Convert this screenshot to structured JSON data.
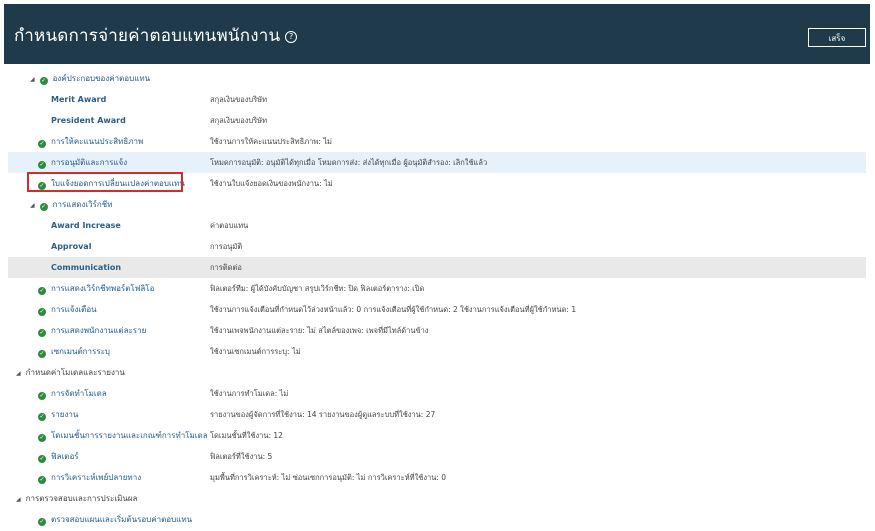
{
  "header": {
    "title": "กำหนดการจ่ายค่าตอบแทนพนักงาน",
    "help_icon": "help-circle-icon",
    "done_label": "เสร็จ"
  },
  "rows": [
    {
      "name": "comp-components",
      "label": "องค์ประกอบของค่าตอบแทน",
      "value": "",
      "expander": true,
      "check": true,
      "level": 1,
      "style": "",
      "interactable": true
    },
    {
      "name": "merit-award",
      "label": "Merit Award",
      "value": "สกุลเงินของบริษัท",
      "expander": false,
      "check": false,
      "level": "sub",
      "style": "",
      "interactable": false
    },
    {
      "name": "president-award",
      "label": "President Award",
      "value": "สกุลเงินของบริษัท",
      "expander": false,
      "check": false,
      "level": "sub",
      "style": "",
      "interactable": false
    },
    {
      "name": "performance-rating",
      "label": "การให้คะแนนประสิทธิภาพ",
      "value": "ใช้งานการให้คะแนนประสิทธิภาพ: ไม่",
      "expander": false,
      "check": true,
      "level": 1,
      "style": "",
      "interactable": true
    },
    {
      "name": "approval-notification",
      "label": "การอนุมัติและการแจ้ง",
      "value": "โหมดการอนุมัติ: อนุมัติได้ทุกเมื่อ  โหมดการส่ง: ส่งได้ทุกเมื่อ  ผู้อนุมัติสำรอง: เลิกใช้แล้ว",
      "expander": false,
      "check": true,
      "level": 1,
      "style": "hl-blue",
      "interactable": true
    },
    {
      "name": "comp-change-notice",
      "label": "ใบแจ้งยอดการเปลี่ยนแปลงค่าตอบแทน",
      "value": "ใช้งานใบแจ้งยอดเงินของพนักงาน: ไม่",
      "expander": false,
      "check": true,
      "level": 1,
      "style": "",
      "interactable": true
    },
    {
      "name": "workflow-display",
      "label": "การแสดงเวิร์กชีท",
      "value": "",
      "expander": true,
      "check": true,
      "level": 1,
      "style": "",
      "interactable": true
    },
    {
      "name": "award-increase",
      "label": "Award Increase",
      "value": "ค่าตอบแทน",
      "expander": false,
      "check": false,
      "level": "sub",
      "style": "",
      "interactable": false
    },
    {
      "name": "approval",
      "label": "Approval",
      "value": "การอนุมัติ",
      "expander": false,
      "check": false,
      "level": "sub",
      "style": "",
      "interactable": false
    },
    {
      "name": "communication",
      "label": "Communication",
      "value": "การติดต่อ",
      "expander": false,
      "check": false,
      "level": "sub",
      "style": "hl-grey",
      "interactable": false
    },
    {
      "name": "portfolio-worksheet",
      "label": "การแสดงเวิร์กชีทพอร์ตโฟลิโอ",
      "value": "ฟิลเตอร์ทีม: ผู้ได้บังคับบัญชา  สรุปเวิร์กชีท: ปิด  ฟิลเตอร์ตาราง: เปิด",
      "expander": false,
      "check": true,
      "level": 1,
      "style": "",
      "interactable": true
    },
    {
      "name": "alerts",
      "label": "การแจ้งเตือน",
      "value": "ใช้งานการแจ้งเตือนที่กำหนดไว้ล่วงหน้าแล้ว: 0  การแจ้งเตือนที่ผู้ใช้กำหนด: 2  ใช้งานการแจ้งเตือนที่ผู้ใช้กำหนด: 1",
      "expander": false,
      "check": true,
      "level": 1,
      "style": "",
      "interactable": true
    },
    {
      "name": "individual-employee",
      "label": "การแสดงพนักงานแต่ละราย",
      "value": "ใช้งานเพจพนักงานแต่ละราย: ไม่  สไตล์ของเพจ: เพจที่มีไทล์ด้านข้าง",
      "expander": false,
      "check": true,
      "level": 1,
      "style": "",
      "interactable": true
    },
    {
      "name": "system-segment",
      "label": "เซกเมนต์การระบุ",
      "value": "ใช้งานเซกเมนต์การระบุ: ไม่",
      "expander": false,
      "check": true,
      "level": 1,
      "style": "",
      "interactable": true
    },
    {
      "name": "models-reports",
      "label": "กำหนดค่าโมเดลและรายงาน",
      "value": "",
      "expander": true,
      "check": false,
      "level": 0,
      "style": "",
      "interactable": true
    },
    {
      "name": "modeling",
      "label": "การจัดทำโมเดล",
      "value": "ใช้งานการทำโมเดล: ไม่",
      "expander": false,
      "check": true,
      "level": 1,
      "style": "",
      "interactable": true
    },
    {
      "name": "reports",
      "label": "รายงาน",
      "value": "รายงานของผู้จัดการที่ใช้งาน: 14  รายงานของผู้ดูแลระบบที่ใช้งาน: 27",
      "expander": false,
      "check": true,
      "level": 1,
      "style": "",
      "interactable": true
    },
    {
      "name": "report-domains",
      "label": "โดเมนชั้นการรายงานและเกณฑ์การทำโมเดล",
      "value": "โดเมนชั้นที่ใช้งาน: 12",
      "expander": false,
      "check": true,
      "level": 1,
      "style": "",
      "interactable": true
    },
    {
      "name": "filters",
      "label": "ฟิลเตอร์",
      "value": "ฟิลเตอร์ที่ใช้งาน: 5",
      "expander": false,
      "check": true,
      "level": 1,
      "style": "",
      "interactable": true
    },
    {
      "name": "target-analysis",
      "label": "การวิเคราะห์เพย์ปลายทาง",
      "value": "มุมพื้นที่การวิเคราะห์: ไม่  ซ่อนเซกการอนุมัติ: ไม่  การวิเคราะห์ที่ใช้งาน: 0",
      "expander": false,
      "check": true,
      "level": 1,
      "style": "",
      "interactable": true
    },
    {
      "name": "review-evaluate",
      "label": "การตรวจสอบและการประเมินผล",
      "value": "",
      "expander": true,
      "check": false,
      "level": 0,
      "style": "",
      "interactable": true
    },
    {
      "name": "review-plan",
      "label": "ตรวจสอบแผนและเริ่มต้นรอบค่าตอบแทน",
      "value": "",
      "expander": false,
      "check": true,
      "level": 1,
      "style": "",
      "interactable": true
    }
  ]
}
